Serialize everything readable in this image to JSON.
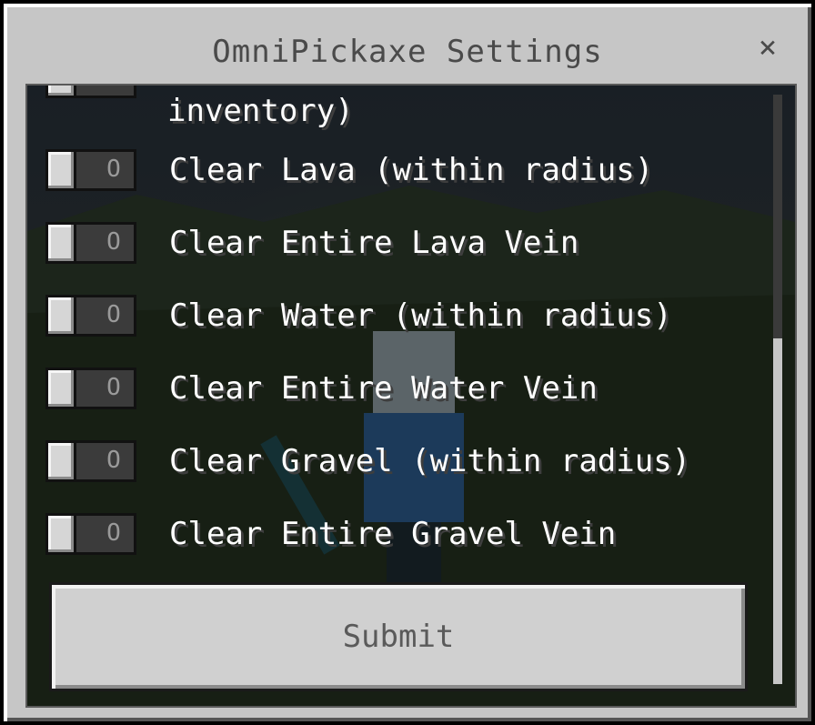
{
  "dialog": {
    "title": "OmniPickaxe Settings",
    "close_symbol": "×"
  },
  "options": {
    "partial_label": "inventory)",
    "toggles": [
      {
        "label": "Clear Lava (within radius)",
        "state": "O"
      },
      {
        "label": "Clear Entire Lava Vein",
        "state": "O"
      },
      {
        "label": "Clear Water (within radius)",
        "state": "O"
      },
      {
        "label": "Clear Entire Water Vein",
        "state": "O"
      },
      {
        "label": "Clear Gravel (within radius)",
        "state": "O"
      },
      {
        "label": "Clear Entire Gravel Vein",
        "state": "O"
      }
    ]
  },
  "submit_label": "Submit",
  "colors": {
    "panel": "#c6c6c6",
    "toggle_off": "#3b3b3b",
    "text": "#ffffff"
  }
}
